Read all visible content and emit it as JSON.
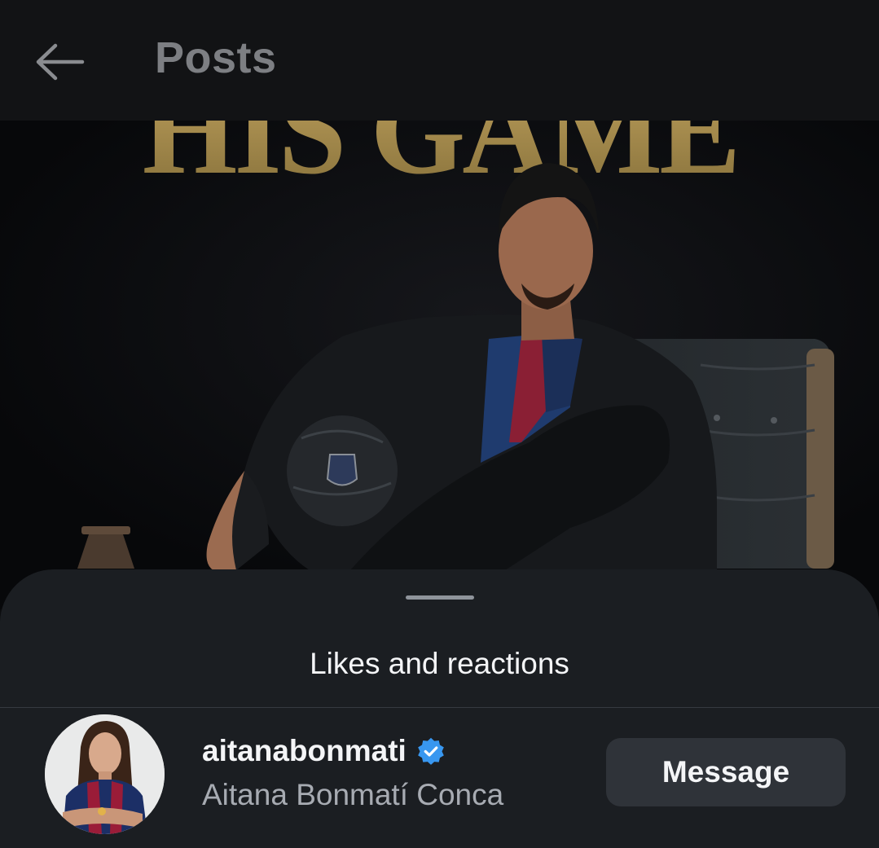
{
  "header": {
    "back_icon": "arrow-left-icon",
    "title": "Posts"
  },
  "post": {
    "image_text": "HIS GAME"
  },
  "sheet": {
    "title": "Likes and reactions"
  },
  "likes": [
    {
      "username": "aitanabonmati",
      "verified": true,
      "full_name": "Aitana Bonmatí Conca",
      "action_label": "Message"
    }
  ],
  "colors": {
    "background": "#0c0d0f",
    "header": "#121315",
    "sheet": "#1b1e22",
    "button": "#2f3339",
    "verified": "#3897f0",
    "poster_gold": "#a68a49",
    "secondary_text": "#a7abb2"
  }
}
